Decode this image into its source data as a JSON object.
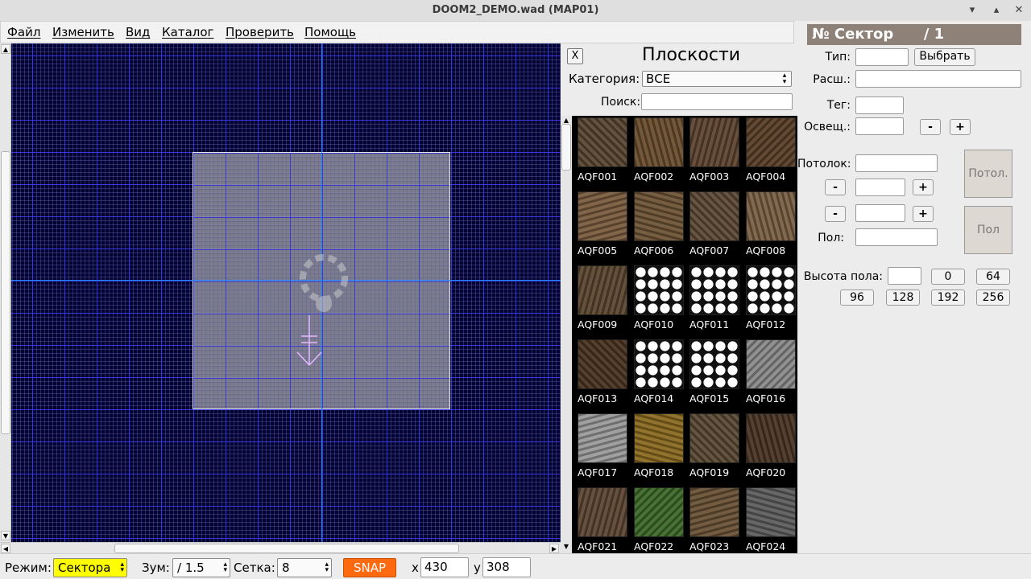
{
  "window": {
    "title": "DOOM2_DEMO.wad (MAP01)",
    "min_icon": "minimize-icon",
    "max_icon": "maximize-icon",
    "close_icon": "close-icon"
  },
  "menu": [
    "Файл",
    "Изменить",
    "Вид",
    "Каталог",
    "Проверить",
    "Помощь"
  ],
  "flats_panel": {
    "close_label": "X",
    "title": "Плоскости",
    "category_label": "Категория:",
    "category_value": "ВСЕ",
    "search_label": "Поиск:",
    "search_value": "",
    "items": [
      {
        "name": "AQF001",
        "color": "#5a4632"
      },
      {
        "name": "AQF002",
        "color": "#6b4e2e"
      },
      {
        "name": "AQF003",
        "color": "#5e4430"
      },
      {
        "name": "AQF004",
        "color": "#5a3f28"
      },
      {
        "name": "AQF005",
        "color": "#7a5c3e"
      },
      {
        "name": "AQF006",
        "color": "#6e5436"
      },
      {
        "name": "AQF007",
        "color": "#5e4a36"
      },
      {
        "name": "AQF008",
        "color": "#7a6044"
      },
      {
        "name": "AQF009",
        "color": "#5b4630"
      },
      {
        "name": "AQF010",
        "color": "#ffffff"
      },
      {
        "name": "AQF011",
        "color": "#ffffff"
      },
      {
        "name": "AQF012",
        "color": "#ffffff"
      },
      {
        "name": "AQF013",
        "color": "#4a3420"
      },
      {
        "name": "AQF014",
        "color": "#ffffff"
      },
      {
        "name": "AQF015",
        "color": "#ffffff"
      },
      {
        "name": "AQF016",
        "color": "#8a8a8a"
      },
      {
        "name": "AQF017",
        "color": "#9a9a9a"
      },
      {
        "name": "AQF018",
        "color": "#8a6a20"
      },
      {
        "name": "AQF019",
        "color": "#5a4a34"
      },
      {
        "name": "AQF020",
        "color": "#4a3424"
      },
      {
        "name": "AQF021",
        "color": "#5e4632"
      },
      {
        "name": "AQF022",
        "color": "#3e6a2a"
      },
      {
        "name": "AQF023",
        "color": "#6a5236"
      },
      {
        "name": "AQF024",
        "color": "#5e5e5e"
      }
    ]
  },
  "sector_panel": {
    "header": "№ Сектор      / 1",
    "type_label": "Тип:",
    "type_value": "",
    "choose_label": "Выбрать",
    "ext_label": "Расш.:",
    "ext_value": "",
    "tag_label": "Тег:",
    "tag_value": "",
    "light_label": "Освещ.:",
    "light_value": "",
    "minus": "-",
    "plus": "+",
    "ceiling_label": "Потолок:",
    "ceiling_value": "",
    "ceiling_height": "",
    "floor_height_box": "",
    "floor_label": "Пол:",
    "floor_value": "",
    "ceiling_tex_label": "Потол.",
    "floor_tex_label": "Пол",
    "floor_height_label": "Высота пола:",
    "floor_height_value": "",
    "height_presets": [
      "0",
      "64",
      "96",
      "128",
      "192",
      "256"
    ]
  },
  "status": {
    "mode_label": "Режим:",
    "mode_value": "Сектора",
    "zoom_label": "Зум:",
    "zoom_value": "/ 1.5",
    "grid_label": "Сетка:",
    "grid_value": "8",
    "snap_label": "SNAP",
    "x_label": "x",
    "x_value": "430",
    "y_label": "y",
    "y_value": "308"
  },
  "colors": {
    "map_bg": "#030332",
    "grid": "#3c3cff",
    "axis": "#1e86ff",
    "snap": "#ff6a10",
    "mode_highlight": "#ffff00",
    "sector_header": "#8e8177"
  }
}
